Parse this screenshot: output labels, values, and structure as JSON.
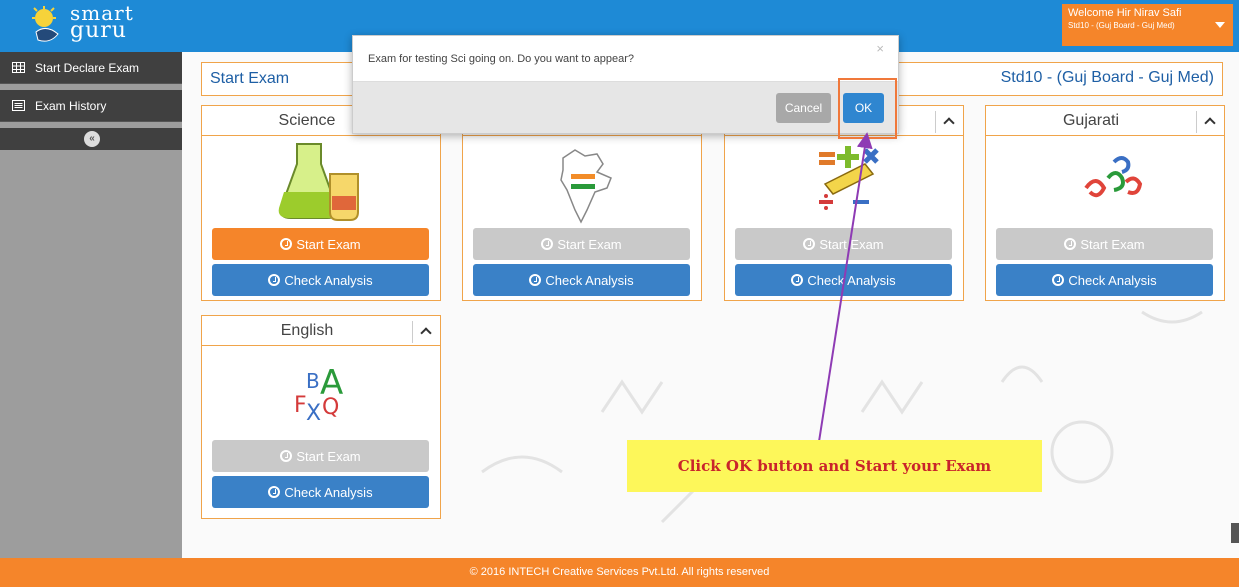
{
  "brand": {
    "line1": "smart",
    "line2": "guru"
  },
  "user": {
    "welcome": "Welcome Hir Nirav Safi",
    "std": "Std10 - (Guj Board - Guj Med)"
  },
  "sidebar": {
    "items": [
      {
        "label": "Start Declare Exam",
        "icon": "table-icon"
      },
      {
        "label": "Exam History",
        "icon": "list-icon"
      }
    ],
    "collapse_label": "«"
  },
  "page": {
    "title": "Start Exam",
    "std_label": "Std10 - (Guj Board - Guj Med)"
  },
  "subjects": [
    {
      "name": "Science",
      "start": "Start Exam",
      "analysis": "Check Analysis",
      "start_enabled": true
    },
    {
      "name": "",
      "start": "Start Exam",
      "analysis": "Check Analysis",
      "start_enabled": false
    },
    {
      "name": "",
      "start": "Start Exam",
      "analysis": "Check Analysis",
      "start_enabled": false
    },
    {
      "name": "Gujarati",
      "start": "Start Exam",
      "analysis": "Check Analysis",
      "start_enabled": false
    },
    {
      "name": "English",
      "start": "Start Exam",
      "analysis": "Check Analysis",
      "start_enabled": false
    }
  ],
  "modal": {
    "message": "Exam for testing Sci going on. Do you want to appear?",
    "close": "×",
    "cancel": "Cancel",
    "ok": "OK"
  },
  "annotation": "Click OK button and Start your Exam",
  "footer": "© 2016 INTECH Creative Services Pvt.Ltd. All rights reserved",
  "colors": {
    "topbar": "#1e8ad6",
    "accent": "#f5852a",
    "primary_button": "#3a81c7",
    "disabled_button": "#c9c9c9",
    "sidebar": "#404040"
  }
}
